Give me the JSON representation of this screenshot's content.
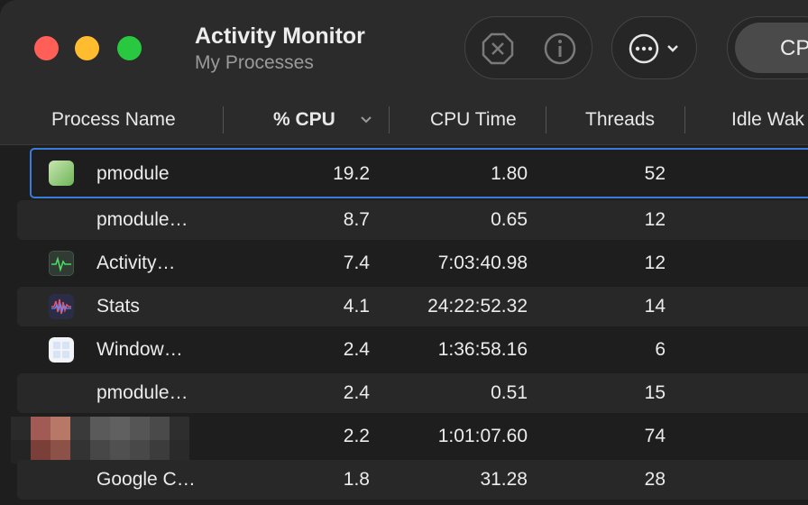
{
  "window": {
    "title": "Activity Monitor",
    "subtitle": "My Processes"
  },
  "toolbar": {
    "stop_icon": "stop-process-icon",
    "info_icon": "info-icon",
    "more_icon": "more-options-icon",
    "cpu_tab": "CPU"
  },
  "columns": {
    "name": "Process Name",
    "cpu": "% CPU",
    "cpu_time": "CPU Time",
    "threads": "Threads",
    "idle": "Idle Wak"
  },
  "rows": [
    {
      "name": "pmodule",
      "cpu": "19.2",
      "time": "1.80",
      "threads": "52",
      "icon": "pmodule-icon"
    },
    {
      "name": "pmodule…",
      "cpu": "8.7",
      "time": "0.65",
      "threads": "12",
      "icon": ""
    },
    {
      "name": "Activity…",
      "cpu": "7.4",
      "time": "7:03:40.98",
      "threads": "12",
      "icon": "activity-monitor-icon"
    },
    {
      "name": "Stats",
      "cpu": "4.1",
      "time": "24:22:52.32",
      "threads": "14",
      "icon": "stats-icon"
    },
    {
      "name": "Window…",
      "cpu": "2.4",
      "time": "1:36:58.16",
      "threads": "6",
      "icon": "window-icon"
    },
    {
      "name": "pmodule…",
      "cpu": "2.4",
      "time": "0.51",
      "threads": "15",
      "icon": ""
    },
    {
      "name": "",
      "cpu": "2.2",
      "time": "1:01:07.60",
      "threads": "74",
      "icon": "redacted"
    },
    {
      "name": "Google C…",
      "cpu": "1.8",
      "time": "31.28",
      "threads": "28",
      "icon": ""
    }
  ],
  "colors": {
    "accent": "#3b7bdc",
    "close": "#ff5f57",
    "minimize": "#febc2e",
    "maximize": "#28c840"
  }
}
